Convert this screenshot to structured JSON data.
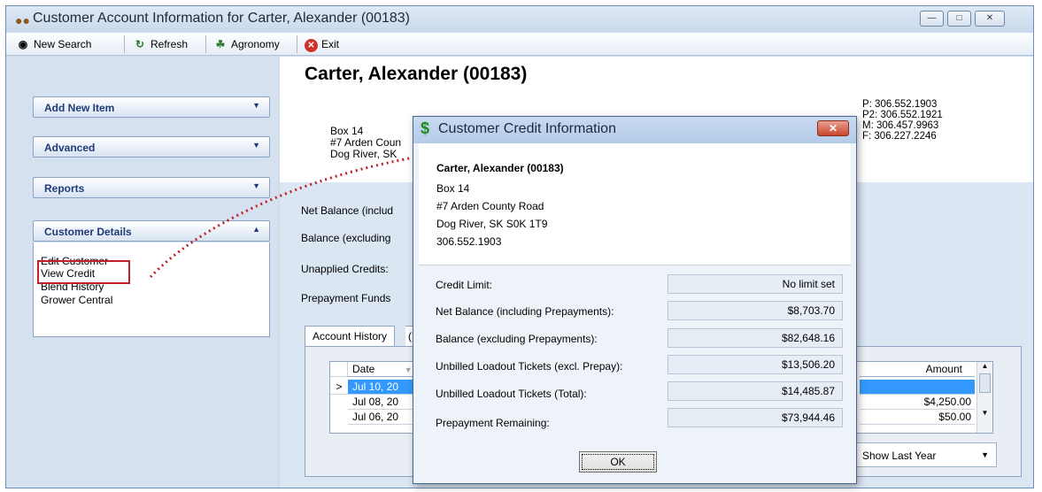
{
  "window": {
    "title": "Customer Account Information for Carter, Alexander (00183)"
  },
  "toolbar": {
    "new_search": "New Search",
    "refresh": "Refresh",
    "agronomy": "Agronomy",
    "exit": "Exit"
  },
  "sidebar": {
    "groups": [
      {
        "label": "Add New Item"
      },
      {
        "label": "Advanced"
      },
      {
        "label": "Reports"
      },
      {
        "label": "Customer Details"
      }
    ],
    "customer_details_links": [
      "Edit Customer",
      "View Credit",
      "Blend History",
      "Grower Central"
    ]
  },
  "customer": {
    "name": "Carter, Alexander (00183)",
    "address_lines": [
      "Box 14",
      "#7 Arden Coun",
      "Dog River, SK"
    ],
    "phones": [
      "P:  306.552.1903",
      "P2: 306.552.1921",
      "M:  306.457.9963",
      "F:   306.227.2246"
    ]
  },
  "fields": [
    "Net Balance (includ",
    "Balance (excluding",
    "Unapplied Credits:",
    "Prepayment Funds"
  ],
  "tabs": [
    "Account History",
    "("
  ],
  "grid": {
    "headers": {
      "date": "Date",
      "amount": "Amount"
    },
    "rows": [
      {
        "marker": ">",
        "date": "Jul 10, 20",
        "amount": ""
      },
      {
        "marker": "",
        "date": "Jul 08, 20",
        "amount": "$4,250.00"
      },
      {
        "marker": "",
        "date": "Jul 06, 20",
        "amount": "$50.00"
      }
    ]
  },
  "history_filter": {
    "selected": "Show Last Year"
  },
  "dialog": {
    "title": "Customer Credit Information",
    "name": "Carter, Alexander (00183)",
    "address_lines": [
      "Box 14",
      "#7 Arden County Road",
      "Dog River, SK  S0K 1T9",
      "306.552.1903"
    ],
    "rows": [
      {
        "label": "Credit Limit:",
        "value": "No limit set"
      },
      {
        "label": "Net Balance (including Prepayments):",
        "value": "$8,703.70"
      },
      {
        "label": "Balance (excluding Prepayments):",
        "value": "$82,648.16"
      },
      {
        "label": "Unbilled Loadout Tickets (excl. Prepay):",
        "value": "$13,506.20"
      },
      {
        "label": "Unbilled Loadout Tickets (Total):",
        "value": "$14,485.87"
      },
      {
        "label": "Prepayment Remaining:",
        "value": "$73,944.46"
      }
    ],
    "ok_label": "OK"
  },
  "colors": {
    "highlight_row": "#3399ff",
    "callout_red": "#c0202a"
  }
}
